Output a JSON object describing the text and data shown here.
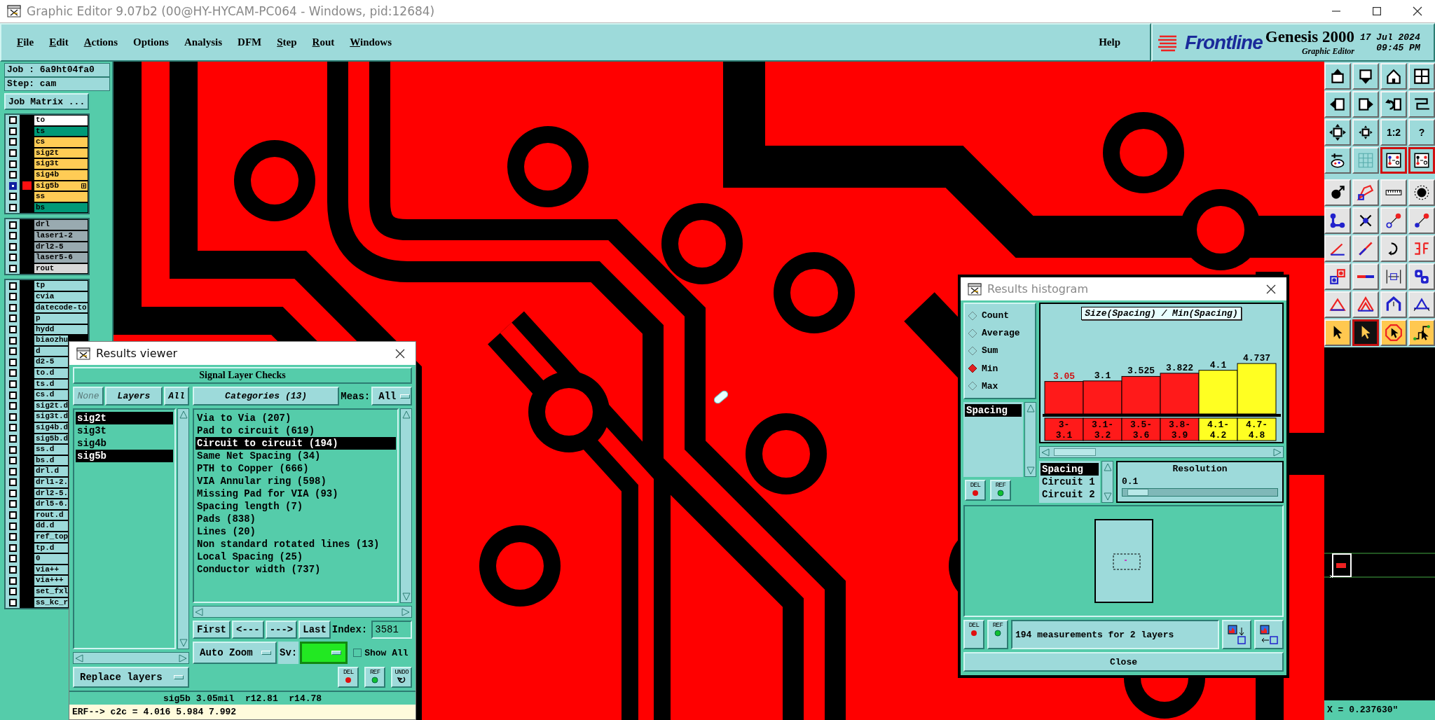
{
  "window": {
    "title": "Graphic Editor 9.07b2 (00@HY-HYCAM-PC064 - Windows, pid:12684)"
  },
  "menu": [
    {
      "label": "File",
      "underlined": true
    },
    {
      "label": "Edit",
      "underlined": true
    },
    {
      "label": "Actions",
      "underlined": true
    },
    {
      "label": "Options",
      "underlined": false
    },
    {
      "label": "Analysis",
      "underlined": false
    },
    {
      "label": "DFM",
      "underlined": false
    },
    {
      "label": "Step",
      "underlined": true
    },
    {
      "label": "Rout",
      "underlined": true
    },
    {
      "label": "Windows",
      "underlined": true
    }
  ],
  "help": "Help",
  "brand": {
    "logo": "Frontline",
    "product": "Genesis 2000",
    "subtitle": "Graphic Editor",
    "date": "17 Jul 2024",
    "time": "09:45 PM"
  },
  "job": {
    "job": "Job : 6a9ht04fa0",
    "step": "Step: cam",
    "matrix_button": "Job Matrix ..."
  },
  "layer_groups": [
    {
      "layers": [
        {
          "name": "to",
          "color": "#ffffff",
          "checked": false,
          "active": false
        },
        {
          "name": "ts",
          "color": "#009977",
          "checked": false,
          "active": false
        },
        {
          "name": "cs",
          "color": "#ffcc55",
          "checked": false,
          "active": false
        },
        {
          "name": "sig2t",
          "color": "#ffcc55",
          "checked": false,
          "active": false
        },
        {
          "name": "sig3t",
          "color": "#ffcc55",
          "checked": false,
          "active": false
        },
        {
          "name": "sig4b",
          "color": "#ffcc55",
          "checked": false,
          "active": false
        },
        {
          "name": "sig5b",
          "color": "#ffcc55",
          "checked": true,
          "active": true
        },
        {
          "name": "ss",
          "color": "#ffcc55",
          "checked": false,
          "active": false
        },
        {
          "name": "bs",
          "color": "#009977",
          "checked": false,
          "active": false
        }
      ]
    },
    {
      "layers": [
        {
          "name": "drl",
          "color": "#99aab0",
          "checked": false,
          "active": false
        },
        {
          "name": "laser1-2",
          "color": "#99aab0",
          "checked": false,
          "active": false
        },
        {
          "name": "drl2-5",
          "color": "#99aab0",
          "checked": false,
          "active": false
        },
        {
          "name": "laser5-6",
          "color": "#99aab0",
          "checked": false,
          "active": false
        },
        {
          "name": "rout",
          "color": "#d8d8d8",
          "checked": false,
          "active": false
        }
      ]
    },
    {
      "layers": [
        {
          "name": "tp",
          "color": "#9ddada",
          "checked": false,
          "active": false
        },
        {
          "name": "cvia",
          "color": "#9ddada",
          "checked": false,
          "active": false
        },
        {
          "name": "datecode-to",
          "color": "#9ddada",
          "checked": false,
          "active": false
        },
        {
          "name": "p",
          "color": "#9ddada",
          "checked": false,
          "active": false
        },
        {
          "name": "hydd",
          "color": "#9ddada",
          "checked": false,
          "active": false
        },
        {
          "name": "biaozhu",
          "color": "#9ddada",
          "checked": false,
          "active": false
        },
        {
          "name": "d",
          "color": "#9ddada",
          "checked": false,
          "active": false
        },
        {
          "name": "d2-5",
          "color": "#9ddada",
          "checked": false,
          "active": false
        },
        {
          "name": "to.d",
          "color": "#9ddada",
          "checked": false,
          "active": false
        },
        {
          "name": "ts.d",
          "color": "#9ddada",
          "checked": false,
          "active": false
        },
        {
          "name": "cs.d",
          "color": "#9ddada",
          "checked": false,
          "active": false
        },
        {
          "name": "sig2t.d",
          "color": "#9ddada",
          "checked": false,
          "active": false
        },
        {
          "name": "sig3t.d",
          "color": "#9ddada",
          "checked": false,
          "active": false
        },
        {
          "name": "sig4b.d",
          "color": "#9ddada",
          "checked": false,
          "active": false
        },
        {
          "name": "sig5b.d",
          "color": "#9ddada",
          "checked": false,
          "active": false
        },
        {
          "name": "ss.d",
          "color": "#9ddada",
          "checked": false,
          "active": false
        },
        {
          "name": "bs.d",
          "color": "#9ddada",
          "checked": false,
          "active": false
        },
        {
          "name": "drl.d",
          "color": "#9ddada",
          "checked": false,
          "active": false
        },
        {
          "name": "drl1-2.",
          "color": "#9ddada",
          "checked": false,
          "active": false
        },
        {
          "name": "drl2-5.",
          "color": "#9ddada",
          "checked": false,
          "active": false
        },
        {
          "name": "drl5-6.",
          "color": "#9ddada",
          "checked": false,
          "active": false
        },
        {
          "name": "rout.d",
          "color": "#9ddada",
          "checked": false,
          "active": false
        },
        {
          "name": "dd.d",
          "color": "#9ddada",
          "checked": false,
          "active": false
        },
        {
          "name": "ref_top",
          "color": "#9ddada",
          "checked": false,
          "active": false
        },
        {
          "name": "tp.d",
          "color": "#9ddada",
          "checked": false,
          "active": false
        },
        {
          "name": "0",
          "color": "#9ddada",
          "checked": false,
          "active": false
        },
        {
          "name": "via++",
          "color": "#9ddada",
          "checked": false,
          "active": false
        },
        {
          "name": "via+++",
          "color": "#9ddada",
          "checked": false,
          "active": false
        },
        {
          "name": "set_fxl",
          "color": "#9ddada",
          "checked": false,
          "active": false
        },
        {
          "name": "ss_kc_r",
          "color": "#9ddada",
          "checked": false,
          "active": false
        }
      ]
    }
  ],
  "toolbar": [
    {
      "kind": "view",
      "on": false
    },
    {
      "kind": "view",
      "on": false
    },
    {
      "kind": "view",
      "on": false
    },
    {
      "kind": "view",
      "on": false
    },
    {
      "kind": "view",
      "on": false
    },
    {
      "kind": "view",
      "on": false
    },
    {
      "kind": "view",
      "on": false
    },
    {
      "kind": "view",
      "on": false
    },
    {
      "kind": "view",
      "on": false
    },
    {
      "kind": "view",
      "on": false
    },
    {
      "kind": "view",
      "on": false,
      "label": "1:2"
    },
    {
      "kind": "view",
      "on": false,
      "label": "?"
    },
    {
      "kind": "view",
      "on": false
    },
    {
      "kind": "view",
      "on": false
    },
    {
      "kind": "view",
      "on": true
    },
    {
      "kind": "view",
      "on": true
    },
    {
      "kind": "tool",
      "on": false
    },
    {
      "kind": "tool",
      "on": false
    },
    {
      "kind": "tool",
      "on": false
    },
    {
      "kind": "tool",
      "on": false
    },
    {
      "kind": "tool",
      "on": false
    },
    {
      "kind": "tool",
      "on": false
    },
    {
      "kind": "tool",
      "on": false
    },
    {
      "kind": "tool",
      "on": false
    },
    {
      "kind": "tool",
      "on": false
    },
    {
      "kind": "tool",
      "on": false
    },
    {
      "kind": "tool",
      "on": false
    },
    {
      "kind": "tool",
      "on": false
    },
    {
      "kind": "tool",
      "on": false
    },
    {
      "kind": "tool",
      "on": false
    },
    {
      "kind": "tool",
      "on": false
    },
    {
      "kind": "tool",
      "on": false
    },
    {
      "kind": "tool",
      "on": false
    },
    {
      "kind": "tool",
      "on": false
    },
    {
      "kind": "tool",
      "on": false
    },
    {
      "kind": "tool",
      "on": false
    },
    {
      "kind": "mode",
      "on": false
    },
    {
      "kind": "mode",
      "on": true
    },
    {
      "kind": "mode",
      "on": false
    },
    {
      "kind": "mode",
      "on": false
    }
  ],
  "coordinates": "X = 0.237630\"",
  "results_viewer": {
    "title": "Results viewer",
    "header": "Signal Layer Checks",
    "layer_buttons": [
      {
        "label": "None",
        "disabled": true
      },
      {
        "label": "Layers",
        "disabled": false
      },
      {
        "label": "All",
        "disabled": false
      }
    ],
    "layers": [
      {
        "name": "sig2t",
        "selected": true
      },
      {
        "name": "sig3t",
        "selected": false
      },
      {
        "name": "sig4b",
        "selected": false
      },
      {
        "name": "sig5b",
        "selected": true
      }
    ],
    "replace": "Replace layers",
    "categories_button": "Categories (13)",
    "meas_label": "Meas:",
    "meas_value": "All",
    "categories": [
      {
        "label": "Via to Via (207)",
        "selected": false
      },
      {
        "label": "Pad to circuit (619)",
        "selected": false
      },
      {
        "label": "Circuit to circuit (194)",
        "selected": true
      },
      {
        "label": "Same Net Spacing (34)",
        "selected": false
      },
      {
        "label": "PTH to Copper (666)",
        "selected": false
      },
      {
        "label": "VIA Annular ring (598)",
        "selected": false
      },
      {
        "label": "Missing Pad for VIA (93)",
        "selected": false
      },
      {
        "label": "Spacing length (7)",
        "selected": false
      },
      {
        "label": "Pads (838)",
        "selected": false
      },
      {
        "label": "Lines (20)",
        "selected": false
      },
      {
        "label": "Non standard rotated lines (13)",
        "selected": false
      },
      {
        "label": "Local Spacing (25)",
        "selected": false
      },
      {
        "label": "Conductor width (737)",
        "selected": false
      }
    ],
    "nav": [
      "First",
      "<---",
      "--->",
      "Last"
    ],
    "index_label": "Index:",
    "index_value": "3581",
    "zoom_mode": "Auto Zoom",
    "sv_label": "Sv:",
    "show_all": {
      "label": "Show All",
      "checked": false
    },
    "actions": [
      "DEL",
      "REF",
      "UNDO"
    ],
    "status": "sig5b 3.05mil  r12.81  r14.78",
    "erf": "ERF--> c2c = 4.016 5.984 7.992"
  },
  "histogram": {
    "title": "Results histogram",
    "modes": [
      {
        "label": "Count",
        "selected": false
      },
      {
        "label": "Average",
        "selected": false
      },
      {
        "label": "Sum",
        "selected": false
      },
      {
        "label": "Min",
        "selected": true
      },
      {
        "label": "Max",
        "selected": false
      }
    ],
    "measures": [
      {
        "label": "Spacing",
        "selected": true
      }
    ],
    "left_actions": [
      "DEL",
      "REF"
    ],
    "chart_data": {
      "type": "bar",
      "title": "Size(Spacing) / Min(Spacing)",
      "categories": [
        "3-\n3.1",
        "3.1-\n3.2",
        "3.5-\n3.6",
        "3.8-\n3.9",
        "4.1-\n4.2",
        "4.7-\n4.8"
      ],
      "values": [
        3.05,
        3.1,
        3.525,
        3.822,
        4.1,
        4.737
      ],
      "data_labels": true
    },
    "bars": [
      {
        "color": "#ff1a1a",
        "selected": true
      },
      {
        "color": "#ff1a1a",
        "selected": false
      },
      {
        "color": "#ff1a1a",
        "selected": false
      },
      {
        "color": "#ff1a1a",
        "selected": false
      },
      {
        "color": "#ffff22",
        "selected": false
      },
      {
        "color": "#ffff22",
        "selected": false
      }
    ],
    "fields": [
      {
        "label": "Spacing",
        "selected": true
      },
      {
        "label": "Circuit 1",
        "selected": false
      },
      {
        "label": "Circuit 2",
        "selected": false
      }
    ],
    "resolution": {
      "label": "Resolution",
      "value": "0.1",
      "level": 0.03
    },
    "bottom_actions": [
      "DEL",
      "REF"
    ],
    "summary": "194 measurements for 2 layers",
    "close": "Close"
  }
}
